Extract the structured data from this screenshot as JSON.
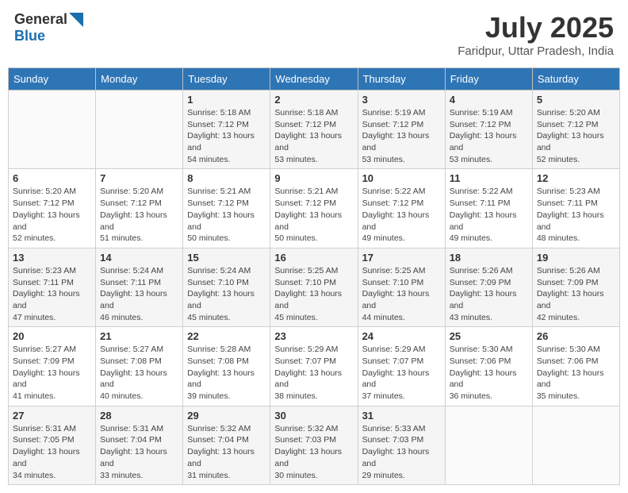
{
  "header": {
    "logo_general": "General",
    "logo_blue": "Blue",
    "title": "July 2025",
    "location": "Faridpur, Uttar Pradesh, India"
  },
  "days_of_week": [
    "Sunday",
    "Monday",
    "Tuesday",
    "Wednesday",
    "Thursday",
    "Friday",
    "Saturday"
  ],
  "weeks": [
    [
      {
        "day": "",
        "sunrise": "",
        "sunset": "",
        "daylight": ""
      },
      {
        "day": "",
        "sunrise": "",
        "sunset": "",
        "daylight": ""
      },
      {
        "day": "1",
        "sunrise": "Sunrise: 5:18 AM",
        "sunset": "Sunset: 7:12 PM",
        "daylight": "Daylight: 13 hours and 54 minutes."
      },
      {
        "day": "2",
        "sunrise": "Sunrise: 5:18 AM",
        "sunset": "Sunset: 7:12 PM",
        "daylight": "Daylight: 13 hours and 53 minutes."
      },
      {
        "day": "3",
        "sunrise": "Sunrise: 5:19 AM",
        "sunset": "Sunset: 7:12 PM",
        "daylight": "Daylight: 13 hours and 53 minutes."
      },
      {
        "day": "4",
        "sunrise": "Sunrise: 5:19 AM",
        "sunset": "Sunset: 7:12 PM",
        "daylight": "Daylight: 13 hours and 53 minutes."
      },
      {
        "day": "5",
        "sunrise": "Sunrise: 5:20 AM",
        "sunset": "Sunset: 7:12 PM",
        "daylight": "Daylight: 13 hours and 52 minutes."
      }
    ],
    [
      {
        "day": "6",
        "sunrise": "Sunrise: 5:20 AM",
        "sunset": "Sunset: 7:12 PM",
        "daylight": "Daylight: 13 hours and 52 minutes."
      },
      {
        "day": "7",
        "sunrise": "Sunrise: 5:20 AM",
        "sunset": "Sunset: 7:12 PM",
        "daylight": "Daylight: 13 hours and 51 minutes."
      },
      {
        "day": "8",
        "sunrise": "Sunrise: 5:21 AM",
        "sunset": "Sunset: 7:12 PM",
        "daylight": "Daylight: 13 hours and 50 minutes."
      },
      {
        "day": "9",
        "sunrise": "Sunrise: 5:21 AM",
        "sunset": "Sunset: 7:12 PM",
        "daylight": "Daylight: 13 hours and 50 minutes."
      },
      {
        "day": "10",
        "sunrise": "Sunrise: 5:22 AM",
        "sunset": "Sunset: 7:12 PM",
        "daylight": "Daylight: 13 hours and 49 minutes."
      },
      {
        "day": "11",
        "sunrise": "Sunrise: 5:22 AM",
        "sunset": "Sunset: 7:11 PM",
        "daylight": "Daylight: 13 hours and 49 minutes."
      },
      {
        "day": "12",
        "sunrise": "Sunrise: 5:23 AM",
        "sunset": "Sunset: 7:11 PM",
        "daylight": "Daylight: 13 hours and 48 minutes."
      }
    ],
    [
      {
        "day": "13",
        "sunrise": "Sunrise: 5:23 AM",
        "sunset": "Sunset: 7:11 PM",
        "daylight": "Daylight: 13 hours and 47 minutes."
      },
      {
        "day": "14",
        "sunrise": "Sunrise: 5:24 AM",
        "sunset": "Sunset: 7:11 PM",
        "daylight": "Daylight: 13 hours and 46 minutes."
      },
      {
        "day": "15",
        "sunrise": "Sunrise: 5:24 AM",
        "sunset": "Sunset: 7:10 PM",
        "daylight": "Daylight: 13 hours and 45 minutes."
      },
      {
        "day": "16",
        "sunrise": "Sunrise: 5:25 AM",
        "sunset": "Sunset: 7:10 PM",
        "daylight": "Daylight: 13 hours and 45 minutes."
      },
      {
        "day": "17",
        "sunrise": "Sunrise: 5:25 AM",
        "sunset": "Sunset: 7:10 PM",
        "daylight": "Daylight: 13 hours and 44 minutes."
      },
      {
        "day": "18",
        "sunrise": "Sunrise: 5:26 AM",
        "sunset": "Sunset: 7:09 PM",
        "daylight": "Daylight: 13 hours and 43 minutes."
      },
      {
        "day": "19",
        "sunrise": "Sunrise: 5:26 AM",
        "sunset": "Sunset: 7:09 PM",
        "daylight": "Daylight: 13 hours and 42 minutes."
      }
    ],
    [
      {
        "day": "20",
        "sunrise": "Sunrise: 5:27 AM",
        "sunset": "Sunset: 7:09 PM",
        "daylight": "Daylight: 13 hours and 41 minutes."
      },
      {
        "day": "21",
        "sunrise": "Sunrise: 5:27 AM",
        "sunset": "Sunset: 7:08 PM",
        "daylight": "Daylight: 13 hours and 40 minutes."
      },
      {
        "day": "22",
        "sunrise": "Sunrise: 5:28 AM",
        "sunset": "Sunset: 7:08 PM",
        "daylight": "Daylight: 13 hours and 39 minutes."
      },
      {
        "day": "23",
        "sunrise": "Sunrise: 5:29 AM",
        "sunset": "Sunset: 7:07 PM",
        "daylight": "Daylight: 13 hours and 38 minutes."
      },
      {
        "day": "24",
        "sunrise": "Sunrise: 5:29 AM",
        "sunset": "Sunset: 7:07 PM",
        "daylight": "Daylight: 13 hours and 37 minutes."
      },
      {
        "day": "25",
        "sunrise": "Sunrise: 5:30 AM",
        "sunset": "Sunset: 7:06 PM",
        "daylight": "Daylight: 13 hours and 36 minutes."
      },
      {
        "day": "26",
        "sunrise": "Sunrise: 5:30 AM",
        "sunset": "Sunset: 7:06 PM",
        "daylight": "Daylight: 13 hours and 35 minutes."
      }
    ],
    [
      {
        "day": "27",
        "sunrise": "Sunrise: 5:31 AM",
        "sunset": "Sunset: 7:05 PM",
        "daylight": "Daylight: 13 hours and 34 minutes."
      },
      {
        "day": "28",
        "sunrise": "Sunrise: 5:31 AM",
        "sunset": "Sunset: 7:04 PM",
        "daylight": "Daylight: 13 hours and 33 minutes."
      },
      {
        "day": "29",
        "sunrise": "Sunrise: 5:32 AM",
        "sunset": "Sunset: 7:04 PM",
        "daylight": "Daylight: 13 hours and 31 minutes."
      },
      {
        "day": "30",
        "sunrise": "Sunrise: 5:32 AM",
        "sunset": "Sunset: 7:03 PM",
        "daylight": "Daylight: 13 hours and 30 minutes."
      },
      {
        "day": "31",
        "sunrise": "Sunrise: 5:33 AM",
        "sunset": "Sunset: 7:03 PM",
        "daylight": "Daylight: 13 hours and 29 minutes."
      },
      {
        "day": "",
        "sunrise": "",
        "sunset": "",
        "daylight": ""
      },
      {
        "day": "",
        "sunrise": "",
        "sunset": "",
        "daylight": ""
      }
    ]
  ]
}
